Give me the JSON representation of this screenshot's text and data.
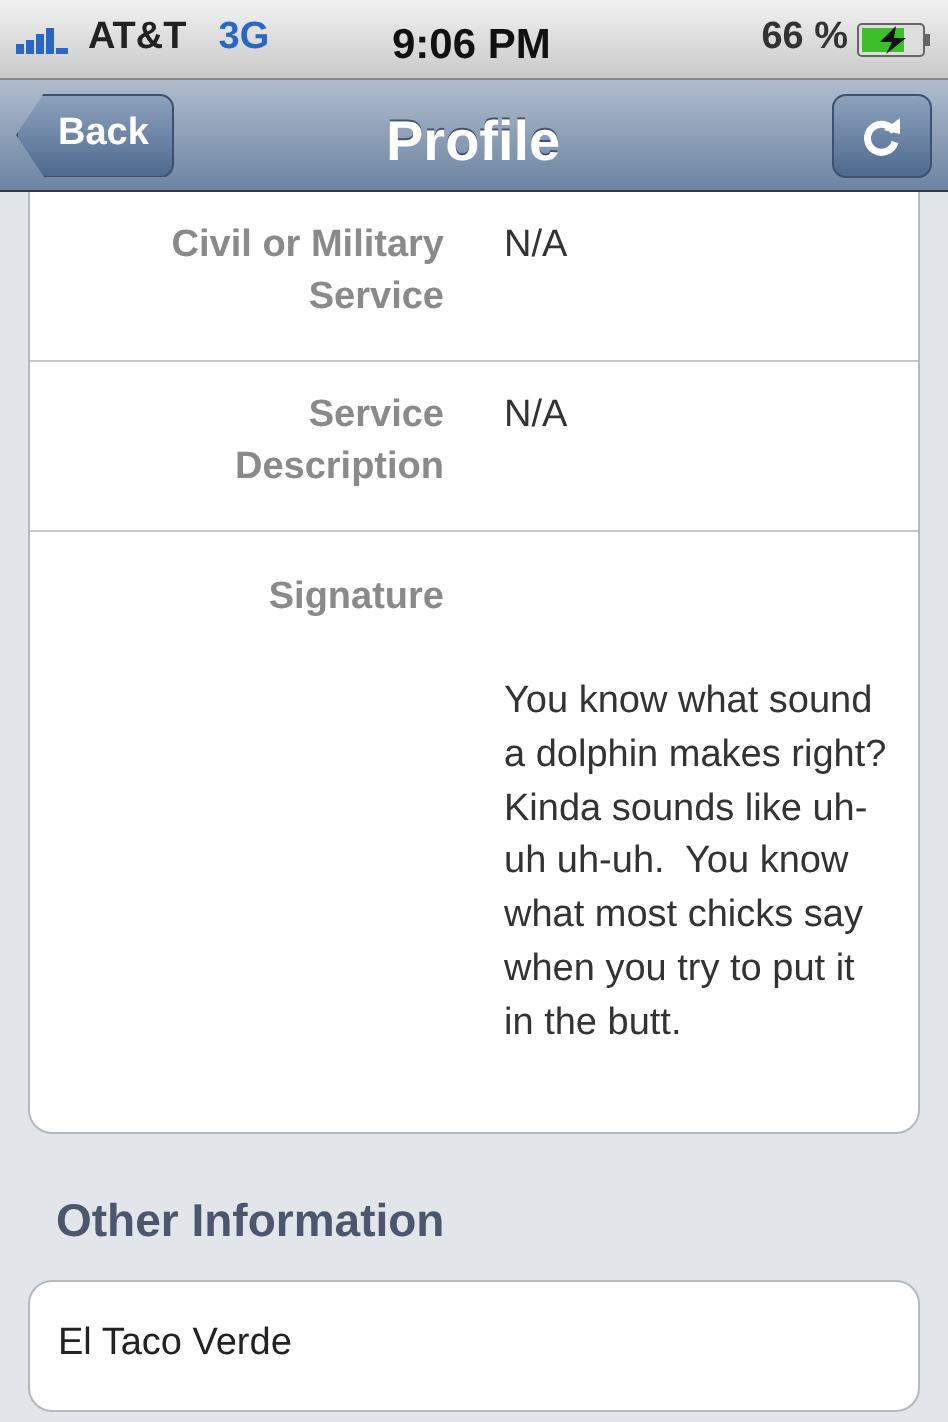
{
  "status_bar": {
    "carrier": "AT&T",
    "network": "3G",
    "time": "9:06 PM",
    "battery": "66 %"
  },
  "nav_bar": {
    "back": "Back",
    "title": "Profile"
  },
  "details": [
    {
      "kind": "short",
      "label": "Civil or Military Service",
      "value": "N/A"
    },
    {
      "kind": "short",
      "label": "Service Description",
      "value": "N/A"
    },
    {
      "kind": "long",
      "label": "Signature",
      "value": "You know what sound a dolphin makes right?  Kinda sounds like uh-uh uh-uh.  You know what most chicks say when you try to put it in the butt."
    }
  ],
  "other_information": {
    "heading": "Other Information",
    "value": "El Taco Verde"
  }
}
